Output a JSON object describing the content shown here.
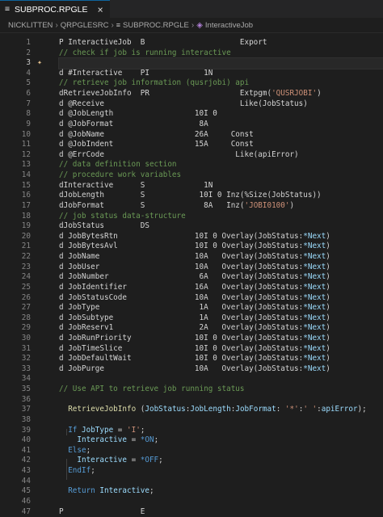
{
  "tab": {
    "label": "SUBPROC.RPGLE",
    "close_glyph": "×"
  },
  "breadcrumb": [
    "NICKLITTEN",
    "QRPGLESRC",
    "SUBPROC.RPGLE",
    "InteractiveJob"
  ],
  "editor": {
    "active_line": 3,
    "lines": [
      {
        "n": "1",
        "s": [
          {
            "t": "P InteractiveJob  B                     Export"
          }
        ]
      },
      {
        "n": "2",
        "s": [
          {
            "t": "// check if job is running interactive",
            "c": "comment"
          }
        ]
      },
      {
        "n": "3",
        "s": [
          {
            "t": ""
          }
        ]
      },
      {
        "n": "4",
        "s": [
          {
            "t": "d #Interactive    PI            1N"
          }
        ]
      },
      {
        "n": "5",
        "s": [
          {
            "t": "// retrieve job information (qusrjobi) api",
            "c": "comment"
          }
        ]
      },
      {
        "n": "6",
        "s": [
          {
            "t": "dRetrieveJobInfo  PR                    Extpgm("
          },
          {
            "t": "'QUSRJOBI'",
            "c": "string"
          },
          {
            "t": ")"
          }
        ]
      },
      {
        "n": "7",
        "s": [
          {
            "t": "d @Receive                              Like(JobStatus)"
          }
        ]
      },
      {
        "n": "8",
        "s": [
          {
            "t": "d @JobLength                  10I 0"
          }
        ]
      },
      {
        "n": "9",
        "s": [
          {
            "t": "d @JobFormat                   8A"
          }
        ]
      },
      {
        "n": "10",
        "s": [
          {
            "t": "d @JobName                    26A     Const"
          }
        ]
      },
      {
        "n": "11",
        "s": [
          {
            "t": "d @JobIndent                  15A     Const"
          }
        ]
      },
      {
        "n": "12",
        "s": [
          {
            "t": "d @ErrCode                             Like(apiError)"
          }
        ]
      },
      {
        "n": "13",
        "s": [
          {
            "t": "// data definition section",
            "c": "comment"
          }
        ]
      },
      {
        "n": "14",
        "s": [
          {
            "t": "// procedure work variables",
            "c": "comment"
          }
        ]
      },
      {
        "n": "15",
        "s": [
          {
            "t": "dInteractive      S             1N"
          }
        ]
      },
      {
        "n": "16",
        "s": [
          {
            "t": "dJobLength        S            10I 0 Inz(%Size(JobStatus))"
          }
        ]
      },
      {
        "n": "17",
        "s": [
          {
            "t": "dJobFormat        S             8A   Inz("
          },
          {
            "t": "'JOBI0100'",
            "c": "string"
          },
          {
            "t": ")"
          }
        ]
      },
      {
        "n": "18",
        "s": [
          {
            "t": "// job status data-structure",
            "c": "comment"
          }
        ]
      },
      {
        "n": "19",
        "s": [
          {
            "t": "dJobStatus        DS"
          }
        ]
      },
      {
        "n": "20",
        "s": [
          {
            "t": "d JobBytesRtn                 10I 0 Overlay(JobStatus:"
          },
          {
            "t": "*Next",
            "c": "var"
          },
          {
            "t": ")"
          }
        ]
      },
      {
        "n": "21",
        "s": [
          {
            "t": "d JobBytesAvl                 10I 0 Overlay(JobStatus:"
          },
          {
            "t": "*Next",
            "c": "var"
          },
          {
            "t": ")"
          }
        ]
      },
      {
        "n": "22",
        "s": [
          {
            "t": "d JobName                     10A   Overlay(JobStatus:"
          },
          {
            "t": "*Next",
            "c": "var"
          },
          {
            "t": ")"
          }
        ]
      },
      {
        "n": "23",
        "s": [
          {
            "t": "d JobUser                     10A   Overlay(JobStatus:"
          },
          {
            "t": "*Next",
            "c": "var"
          },
          {
            "t": ")"
          }
        ]
      },
      {
        "n": "24",
        "s": [
          {
            "t": "d JobNumber                    6A   Overlay(JobStatus:"
          },
          {
            "t": "*Next",
            "c": "var"
          },
          {
            "t": ")"
          }
        ]
      },
      {
        "n": "25",
        "s": [
          {
            "t": "d JobIdentifier               16A   Overlay(JobStatus:"
          },
          {
            "t": "*Next",
            "c": "var"
          },
          {
            "t": ")"
          }
        ]
      },
      {
        "n": "26",
        "s": [
          {
            "t": "d JobStatusCode               10A   Overlay(JobStatus:"
          },
          {
            "t": "*Next",
            "c": "var"
          },
          {
            "t": ")"
          }
        ]
      },
      {
        "n": "27",
        "s": [
          {
            "t": "d JobType                      1A   Overlay(JobStatus:"
          },
          {
            "t": "*Next",
            "c": "var"
          },
          {
            "t": ")"
          }
        ]
      },
      {
        "n": "28",
        "s": [
          {
            "t": "d JobSubtype                   1A   Overlay(JobStatus:"
          },
          {
            "t": "*Next",
            "c": "var"
          },
          {
            "t": ")"
          }
        ]
      },
      {
        "n": "29",
        "s": [
          {
            "t": "d JobReserv1                   2A   Overlay(JobStatus:"
          },
          {
            "t": "*Next",
            "c": "var"
          },
          {
            "t": ")"
          }
        ]
      },
      {
        "n": "30",
        "s": [
          {
            "t": "d JobRunPriority              10I 0 Overlay(JobStatus:"
          },
          {
            "t": "*Next",
            "c": "var"
          },
          {
            "t": ")"
          }
        ]
      },
      {
        "n": "31",
        "s": [
          {
            "t": "d JobTimeSlice                10I 0 Overlay(JobStatus:"
          },
          {
            "t": "*Next",
            "c": "var"
          },
          {
            "t": ")"
          }
        ]
      },
      {
        "n": "32",
        "s": [
          {
            "t": "d JobDefaultWait              10I 0 Overlay(JobStatus:"
          },
          {
            "t": "*Next",
            "c": "var"
          },
          {
            "t": ")"
          }
        ]
      },
      {
        "n": "33",
        "s": [
          {
            "t": "d JobPurge                    10A   Overlay(JobStatus:"
          },
          {
            "t": "*Next",
            "c": "var"
          },
          {
            "t": ")"
          }
        ]
      },
      {
        "n": "34",
        "s": [
          {
            "t": ""
          }
        ]
      },
      {
        "n": "35",
        "s": [
          {
            "t": "// Use API to retrieve job running status",
            "c": "comment"
          }
        ]
      },
      {
        "n": "36",
        "s": [
          {
            "t": ""
          }
        ]
      },
      {
        "n": "37",
        "s": [
          {
            "t": "  "
          },
          {
            "t": "RetrieveJobInfo",
            "c": "fn"
          },
          {
            "t": " ("
          },
          {
            "t": "JobStatus",
            "c": "var"
          },
          {
            "t": ":"
          },
          {
            "t": "JobLength",
            "c": "var"
          },
          {
            "t": ":"
          },
          {
            "t": "JobFormat",
            "c": "var"
          },
          {
            "t": ": "
          },
          {
            "t": "'*'",
            "c": "string"
          },
          {
            "t": ":"
          },
          {
            "t": "' '",
            "c": "string"
          },
          {
            "t": ":"
          },
          {
            "t": "apiError",
            "c": "var"
          },
          {
            "t": ");"
          }
        ]
      },
      {
        "n": "38",
        "s": [
          {
            "t": ""
          }
        ]
      },
      {
        "n": "39",
        "s": [
          {
            "t": "  "
          },
          {
            "t": "If",
            "c": "kw"
          },
          {
            "t": " "
          },
          {
            "t": "JobType",
            "c": "var"
          },
          {
            "t": " = "
          },
          {
            "t": "'I'",
            "c": "string"
          },
          {
            "t": ";"
          }
        ]
      },
      {
        "n": "40",
        "s": [
          {
            "t": "    "
          },
          {
            "t": "Interactive",
            "c": "var"
          },
          {
            "t": " = "
          },
          {
            "t": "*ON",
            "c": "const"
          },
          {
            "t": ";"
          }
        ]
      },
      {
        "n": "41",
        "s": [
          {
            "t": "  "
          },
          {
            "t": "Else",
            "c": "kw"
          },
          {
            "t": ";"
          }
        ]
      },
      {
        "n": "42",
        "s": [
          {
            "t": "    "
          },
          {
            "t": "Interactive",
            "c": "var"
          },
          {
            "t": " = "
          },
          {
            "t": "*OFF",
            "c": "const"
          },
          {
            "t": ";"
          }
        ]
      },
      {
        "n": "43",
        "s": [
          {
            "t": "  "
          },
          {
            "t": "EndIf",
            "c": "kw"
          },
          {
            "t": ";"
          }
        ]
      },
      {
        "n": "44",
        "s": [
          {
            "t": ""
          }
        ]
      },
      {
        "n": "45",
        "s": [
          {
            "t": "  "
          },
          {
            "t": "Return",
            "c": "kw"
          },
          {
            "t": " "
          },
          {
            "t": "Interactive",
            "c": "var"
          },
          {
            "t": ";"
          }
        ]
      },
      {
        "n": "46",
        "s": [
          {
            "t": ""
          }
        ]
      },
      {
        "n": "47",
        "s": [
          {
            "t": "P                 E"
          }
        ]
      }
    ]
  }
}
